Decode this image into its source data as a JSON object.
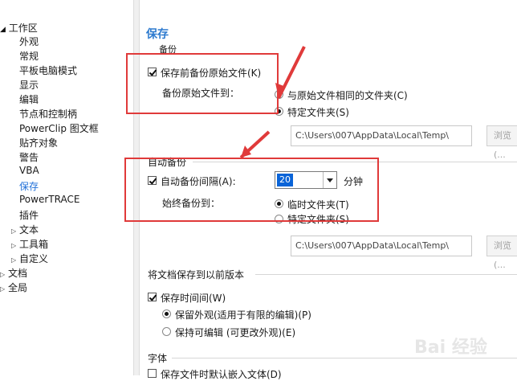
{
  "window": {
    "title_fragment": "项"
  },
  "tree": {
    "workspace": "工作区",
    "items": [
      "外观",
      "常规",
      "平板电脑模式",
      "显示",
      "编辑",
      "节点和控制柄",
      "PowerClip 图文框",
      "贴齐对象",
      "警告",
      "VBA",
      "保存",
      "PowerTRACE",
      "插件"
    ],
    "collapsed_children": [
      "文本",
      "工具箱",
      "自定义"
    ],
    "roots": [
      "文档",
      "全局"
    ],
    "selected": "保存"
  },
  "panel": {
    "title": "保存",
    "backup": {
      "section_label": "备份",
      "checkbox_label": "保存前备份原始文件(K)",
      "checked": true,
      "backup_to_label": "备份原始文件到：",
      "radio_same": "与原始文件相同的文件夹(C)",
      "radio_specific": "特定文件夹(S)",
      "path": "C:\\Users\\007\\AppData\\Local\\Temp\\",
      "browse": "浏览(..."
    },
    "autobackup": {
      "section_label": "自动备份",
      "interval_label": "自动备份间隔(A):",
      "checked": true,
      "interval_value": "20",
      "unit": "分钟",
      "always_to_label": "始终备份到：",
      "radio_temp": "临时文件夹(T)",
      "radio_specific": "特定文件夹(S)",
      "path": "C:\\Users\\007\\AppData\\Local\\Temp\\",
      "browse": "浏览(..."
    },
    "previous": {
      "section_label": "将文档保存到以前版本",
      "keep_time_label": "保存时间间(W)",
      "keep_time_checked": true,
      "radio_appearance": "保留外观(适用于有限的编辑)(P)",
      "radio_editable": "保持可编辑 (可更改外观)(E)"
    },
    "fonts": {
      "section_label": "字体",
      "embed_label": "保存文件时默认嵌入文体(D)"
    }
  },
  "watermark": "Bai 经验",
  "colors": {
    "title": "#2e7bcf",
    "selected": "#1f6fd8",
    "annotation": "#e03a3a",
    "combo_highlight": "#0a64d8"
  }
}
